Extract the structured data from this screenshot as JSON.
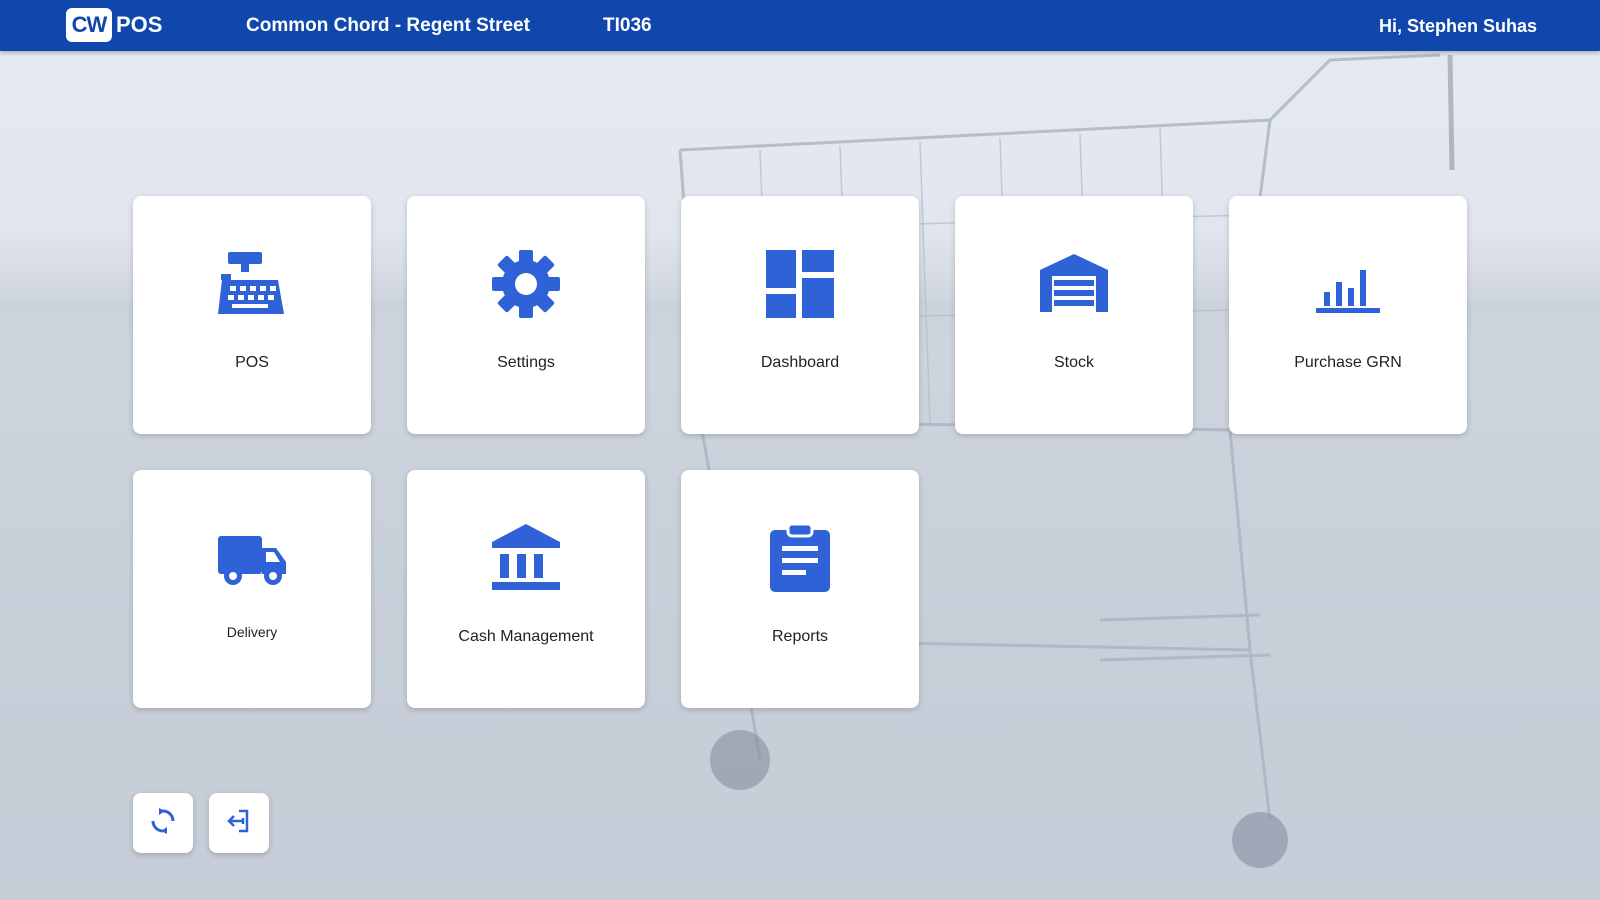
{
  "header": {
    "logo_badge": "CW",
    "logo_text": "POS",
    "store_name": "Common Chord - Regent Street",
    "till_id": "TI036",
    "greeting": "Hi, Stephen Suhas"
  },
  "tiles": [
    {
      "label": "POS",
      "icon": "cash-register-icon"
    },
    {
      "label": "Settings",
      "icon": "gear-icon"
    },
    {
      "label": "Dashboard",
      "icon": "dashboard-icon"
    },
    {
      "label": "Stock",
      "icon": "warehouse-icon"
    },
    {
      "label": "Purchase GRN",
      "icon": "bar-chart-icon"
    },
    {
      "label": "Delivery",
      "icon": "truck-icon"
    },
    {
      "label": "Cash Management",
      "icon": "bank-icon"
    },
    {
      "label": "Reports",
      "icon": "clipboard-icon"
    }
  ],
  "actions": {
    "sync_icon": "sync-icon",
    "logout_icon": "logout-icon"
  },
  "colors": {
    "brand": "#0f47ad",
    "icon": "#2f62d6"
  }
}
